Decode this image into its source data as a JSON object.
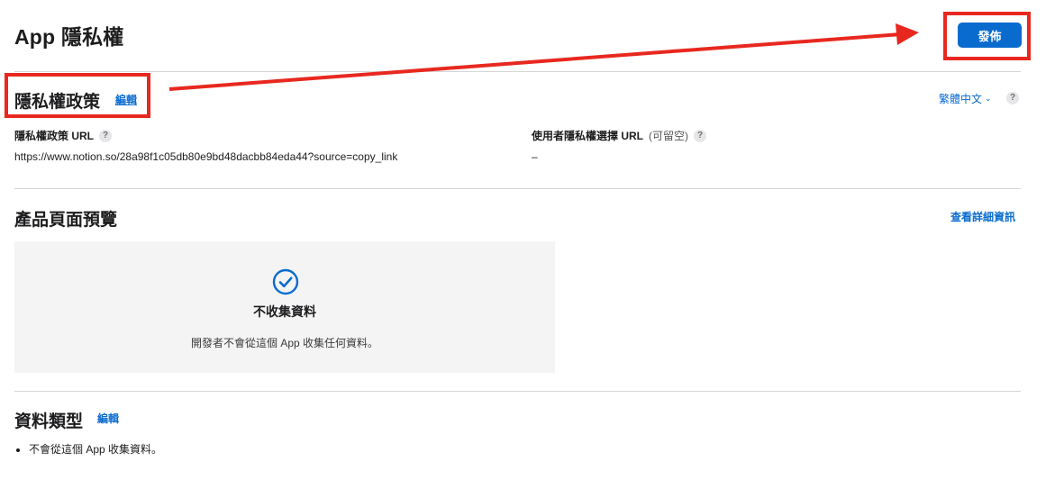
{
  "header": {
    "title": "App 隱私權",
    "publish_label": "發佈"
  },
  "privacy_policy": {
    "heading": "隱私權政策",
    "edit_label": "編輯",
    "language_label": "繁體中文",
    "language_help": "?",
    "url_label": "隱私權政策 URL",
    "url_help": "?",
    "url_value": "https://www.notion.so/28a98f1c05db80e9bd48dacbb84eda44?source=copy_link",
    "choices_label": "使用者隱私權選擇 URL",
    "choices_optional": "(可留空)",
    "choices_help": "?",
    "choices_value": "–"
  },
  "product_preview": {
    "heading": "產品頁面預覽",
    "details_link": "查看詳細資訊",
    "card_title": "不收集資料",
    "card_desc": "開發者不會從這個 App 收集任何資料。"
  },
  "data_types": {
    "heading": "資料類型",
    "edit_label": "編輯",
    "items": [
      "不會從這個 App 收集資料。"
    ]
  },
  "icons": {
    "check": "check-circle-icon",
    "help": "question-circle-icon",
    "chevron": "chevron-down-icon"
  },
  "colors": {
    "accent": "#0a6bce",
    "annotation": "#e8281f",
    "card_bg": "#f4f4f5",
    "divider": "#d6d6d6"
  }
}
